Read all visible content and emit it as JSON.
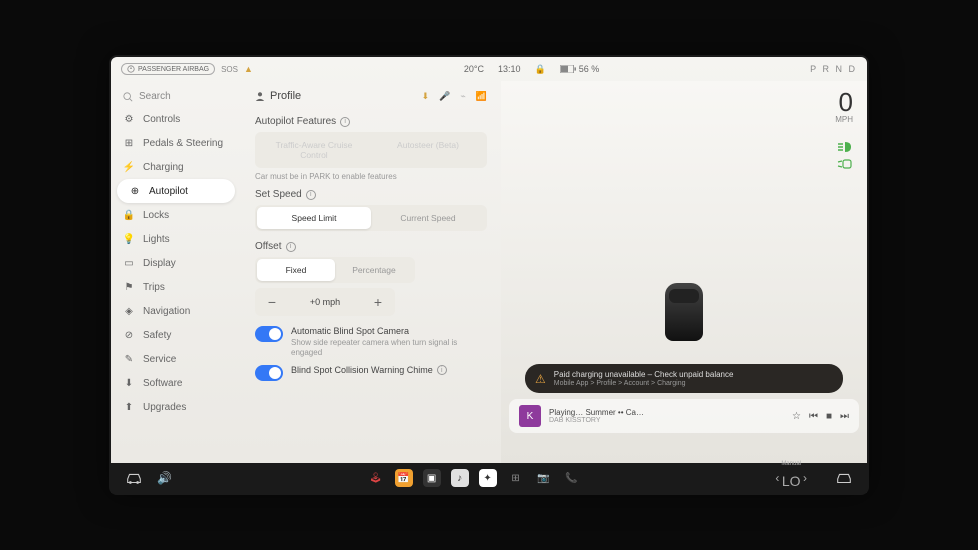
{
  "statusbar": {
    "airbag": "PASSENGER AIRBAG",
    "sos": "SOS",
    "temp": "20°C",
    "time": "13:10",
    "battery": "56 %",
    "gears": "P R N D"
  },
  "sidebar": {
    "search": "Search",
    "items": [
      {
        "icon": "⚙",
        "label": "Controls"
      },
      {
        "icon": "⊞",
        "label": "Pedals & Steering"
      },
      {
        "icon": "⚡",
        "label": "Charging"
      },
      {
        "icon": "⊕",
        "label": "Autopilot"
      },
      {
        "icon": "🔒",
        "label": "Locks"
      },
      {
        "icon": "💡",
        "label": "Lights"
      },
      {
        "icon": "▭",
        "label": "Display"
      },
      {
        "icon": "⚑",
        "label": "Trips"
      },
      {
        "icon": "◈",
        "label": "Navigation"
      },
      {
        "icon": "⊘",
        "label": "Safety"
      },
      {
        "icon": "✎",
        "label": "Service"
      },
      {
        "icon": "⬇",
        "label": "Software"
      },
      {
        "icon": "⬆",
        "label": "Upgrades"
      }
    ],
    "activeIndex": 3
  },
  "settings": {
    "profile": "Profile",
    "autopilot_features": "Autopilot Features",
    "ap_option1": "Traffic-Aware Cruise Control",
    "ap_option2": "Autosteer (Beta)",
    "ap_note": "Car must be in PARK to enable features",
    "set_speed": "Set Speed",
    "speed_opt1": "Speed Limit",
    "speed_opt2": "Current Speed",
    "offset": "Offset",
    "offset_opt1": "Fixed",
    "offset_opt2": "Percentage",
    "offset_value": "+0 mph",
    "toggle1_label": "Automatic Blind Spot Camera",
    "toggle1_desc": "Show side repeater camera when turn signal is engaged",
    "toggle2_label": "Blind Spot Collision Warning Chime"
  },
  "right": {
    "speed": "0",
    "speed_unit": "MPH",
    "warning_title": "Paid charging unavailable – Check unpaid balance",
    "warning_sub": "Mobile App > Profile > Account > Charging",
    "media_track": "Playing… Summer •• Ca…",
    "media_station": "DAB KISSTORY"
  },
  "dock": {
    "climate_mode": "Manual",
    "climate_temp": "LO"
  }
}
